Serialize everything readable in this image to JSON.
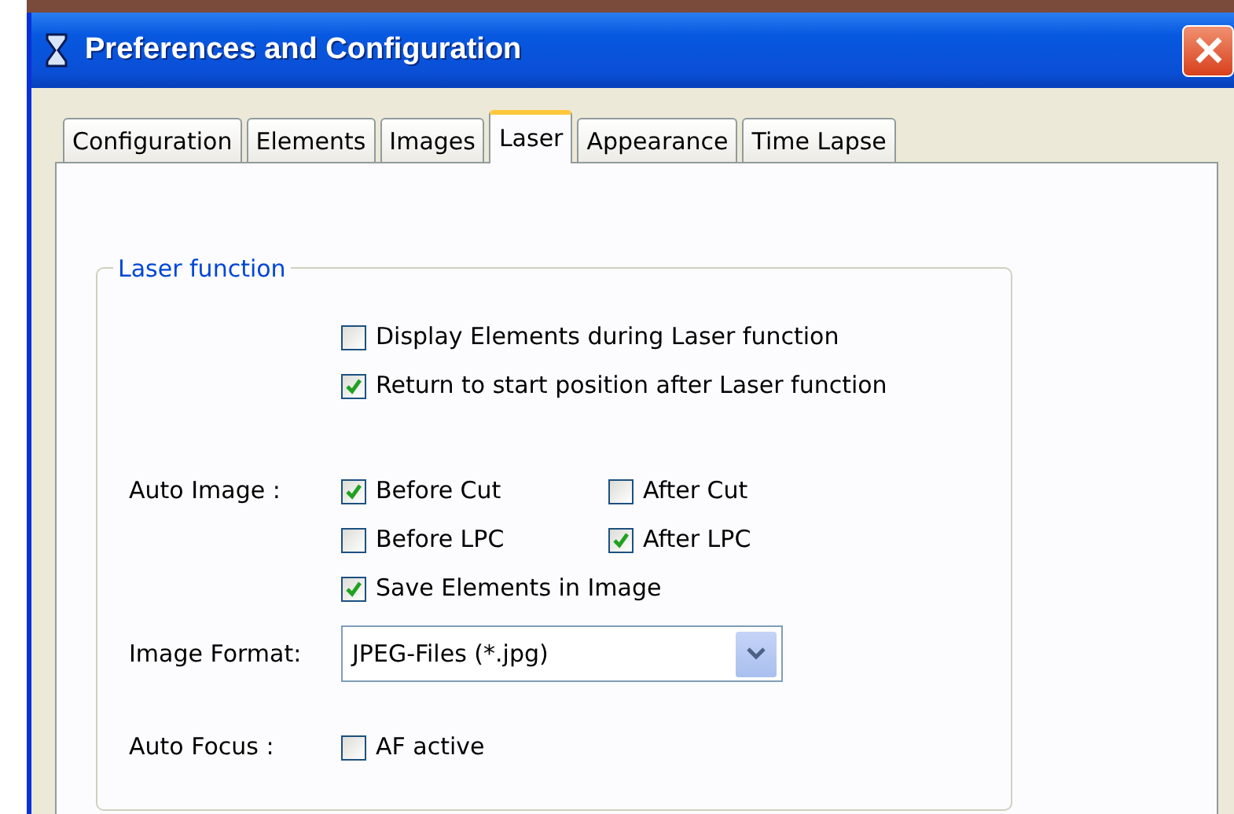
{
  "window": {
    "title": "Preferences and Configuration"
  },
  "tabs": [
    {
      "label": "Configuration",
      "selected": false
    },
    {
      "label": "Elements",
      "selected": false
    },
    {
      "label": "Images",
      "selected": false
    },
    {
      "label": "Laser",
      "selected": true
    },
    {
      "label": "Appearance",
      "selected": false
    },
    {
      "label": "Time Lapse",
      "selected": false
    }
  ],
  "group": {
    "legend": "Laser function",
    "rows": [
      {
        "kind": "checks",
        "items": [
          {
            "label": "Display Elements during Laser function",
            "checked": false
          }
        ]
      },
      {
        "kind": "checks",
        "items": [
          {
            "label": "Return to start position after Laser function",
            "checked": true
          }
        ]
      },
      {
        "kind": "checks",
        "label": "Auto Image :",
        "items": [
          {
            "label": "Before Cut",
            "checked": true
          },
          {
            "label": "After Cut",
            "checked": false
          }
        ]
      },
      {
        "kind": "checks",
        "items": [
          {
            "label": "Before LPC",
            "checked": false
          },
          {
            "label": "After LPC",
            "checked": true
          }
        ]
      },
      {
        "kind": "checks",
        "items": [
          {
            "label": "Save Elements in Image",
            "checked": true
          }
        ]
      },
      {
        "kind": "select",
        "label": "Image Format:",
        "value": "JPEG-Files (*.jpg)"
      },
      {
        "kind": "checks",
        "label": "Auto Focus :",
        "items": [
          {
            "label": "AF active",
            "checked": false
          }
        ]
      }
    ]
  }
}
